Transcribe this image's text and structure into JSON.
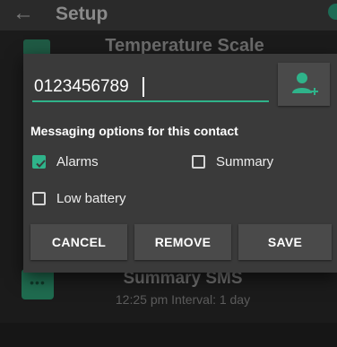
{
  "app": {
    "title": "Setup",
    "back_icon": "arrow-left-icon",
    "background_item_title": "Temperature Scale",
    "sms_item": {
      "title": "Summary SMS",
      "subtitle": "12:25 pm Interval: 1 day",
      "icon": "sms-chat-icon"
    }
  },
  "dialog": {
    "phone_value": "0123456789",
    "add_contact_icon": "add-person-icon",
    "section_label": "Messaging options for this contact",
    "options": [
      {
        "label": "Alarms",
        "checked": true
      },
      {
        "label": "Summary",
        "checked": false
      },
      {
        "label": "Low battery",
        "checked": false
      }
    ],
    "buttons": {
      "cancel": "CANCEL",
      "remove": "REMOVE",
      "save": "SAVE"
    }
  },
  "colors": {
    "accent": "#2fb38a",
    "dialog_bg": "#3a3a3a",
    "button_bg": "#4a4a4a",
    "text": "#ffffff"
  }
}
